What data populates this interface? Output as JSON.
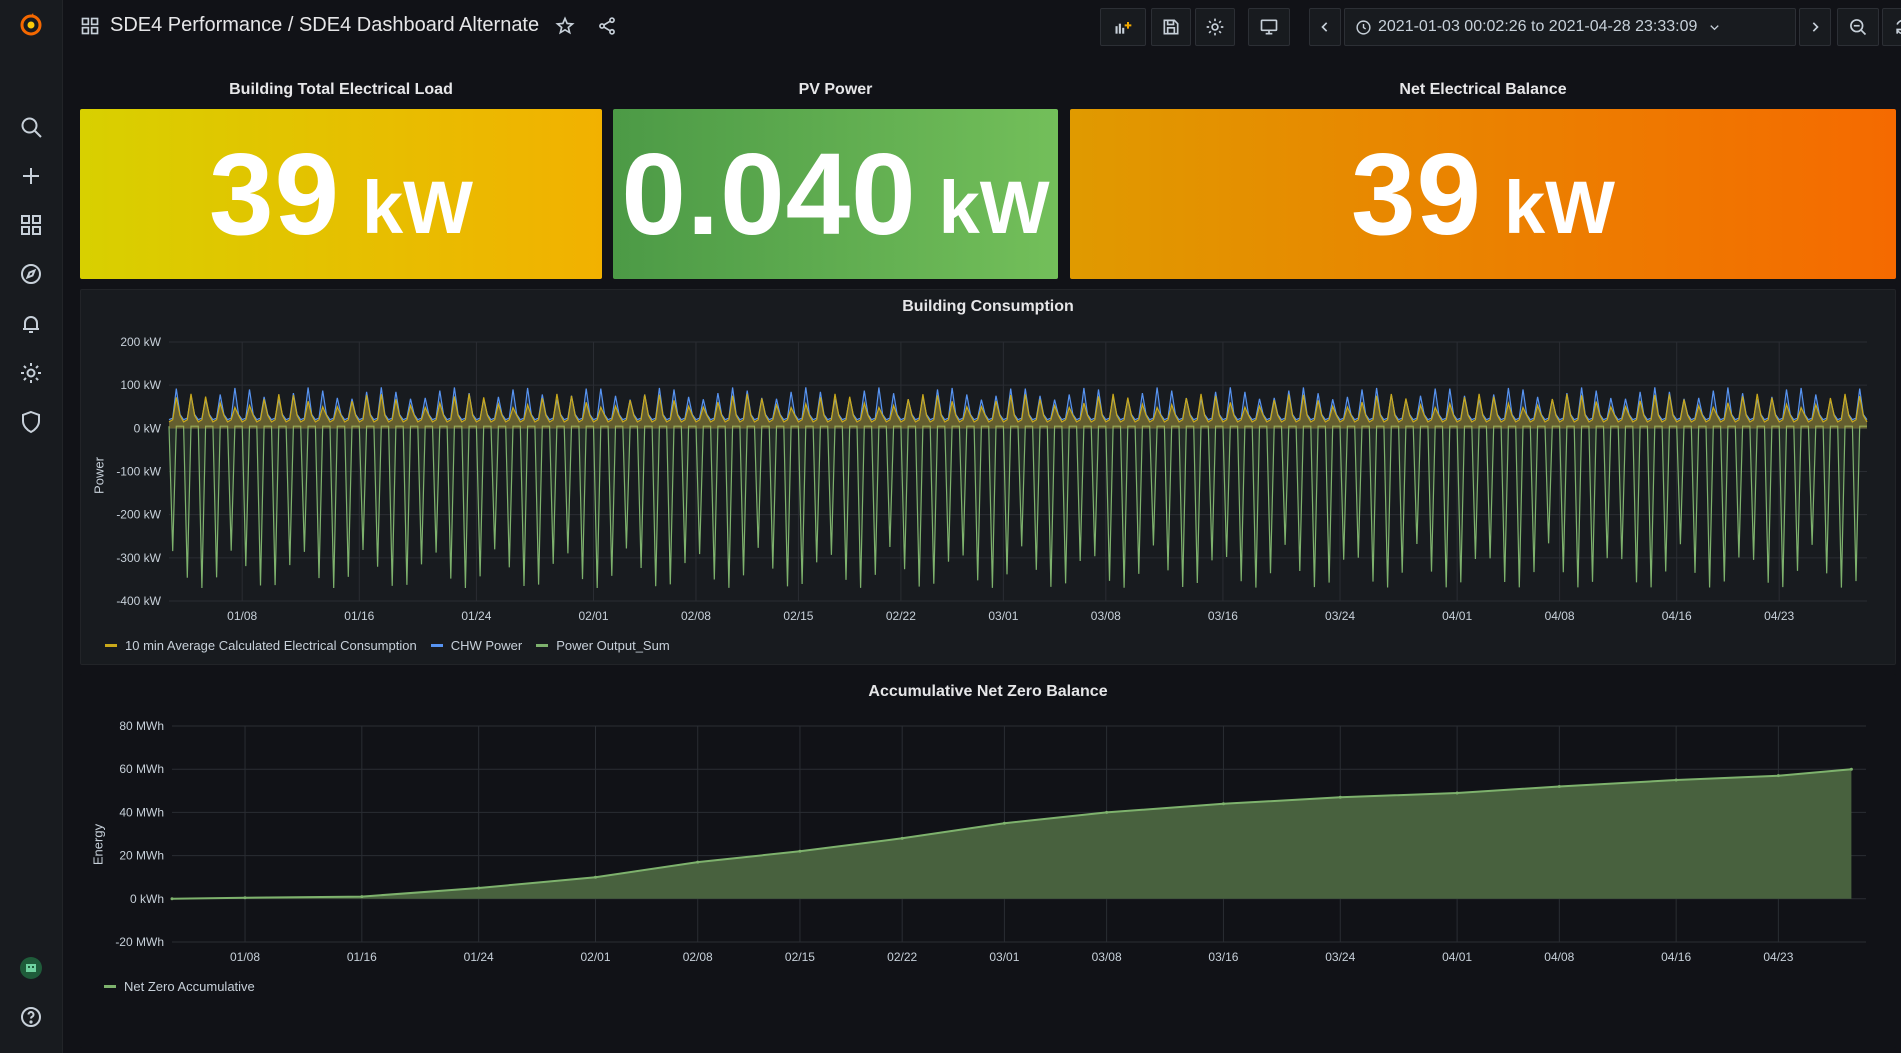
{
  "breadcrumb": {
    "folder": "SDE4 Performance",
    "separator": " / ",
    "dashboard": "SDE4 Dashboard Alternate"
  },
  "time_picker": {
    "range": "2021-01-03 00:02:26 to 2021-04-28 23:33:09"
  },
  "sidebar": {
    "items": [
      "grafana-logo-icon",
      "search-icon",
      "plus-icon",
      "dashboards-icon",
      "explore-icon",
      "alerting-icon",
      "configuration-icon",
      "server-admin-icon",
      "user-avatar",
      "help-icon"
    ]
  },
  "toolbar": {
    "icons": [
      "add-panel-icon",
      "save-icon",
      "settings-icon",
      "tv-mode-icon",
      "time-back-icon",
      "clock-icon",
      "time-forward-icon",
      "zoom-out-icon",
      "refresh-icon",
      "refresh-interval-chevron-icon"
    ]
  },
  "stats": [
    {
      "title": "Building Total Electrical Load",
      "value": "39",
      "unit": "kW",
      "gradient": [
        "#d8d000",
        "#f2b100"
      ]
    },
    {
      "title": "PV Power",
      "value": "0.040",
      "unit": "kW",
      "gradient": [
        "#4c9a46",
        "#73bf5a"
      ]
    },
    {
      "title": "Net Electrical Balance",
      "value": "39",
      "unit": "kW",
      "gradient": [
        "#e09a00",
        "#f56a00"
      ]
    }
  ],
  "colors": {
    "yellow": "#caa91a",
    "blue": "#5794f2",
    "green": "#7eb26d",
    "acc_fill": "#48613e"
  },
  "chart_data": [
    {
      "type": "line",
      "title": "Building Consumption",
      "ylabel": "Power",
      "xlabel": "",
      "ylim": [
        -400,
        200
      ],
      "yticks": [
        "200 kW",
        "100 kW",
        "0 kW",
        "-100 kW",
        "-200 kW",
        "-300 kW",
        "-400 kW"
      ],
      "xticks": [
        "01/08",
        "01/16",
        "01/24",
        "02/01",
        "02/08",
        "02/15",
        "02/22",
        "03/01",
        "03/08",
        "03/16",
        "03/24",
        "04/01",
        "04/08",
        "04/16",
        "04/23"
      ],
      "x_range": [
        "2021-01-03",
        "2021-04-28"
      ],
      "grid": true,
      "legend_position": "bottom-left",
      "series": [
        {
          "name": "10 min Average Calculated Electrical Consumption",
          "color": "#caa91a",
          "typical_base": 15,
          "typical_peak": 80
        },
        {
          "name": "CHW Power",
          "color": "#5794f2",
          "typical_base": 20,
          "typical_peak": 95
        },
        {
          "name": "Power Output_Sum",
          "color": "#7eb26d",
          "typical_base": 5,
          "typical_min": -370
        }
      ]
    },
    {
      "type": "area",
      "title": "Accumulative Net Zero Balance",
      "ylabel": "Energy",
      "xlabel": "",
      "ylim": [
        -20,
        80
      ],
      "yticks": [
        "80 MWh",
        "60 MWh",
        "40 MWh",
        "20 MWh",
        "0 kWh",
        "-20 MWh"
      ],
      "xticks": [
        "01/08",
        "01/16",
        "01/24",
        "02/01",
        "02/08",
        "02/15",
        "02/22",
        "03/01",
        "03/08",
        "03/16",
        "03/24",
        "04/01",
        "04/08",
        "04/16",
        "04/23"
      ],
      "x_range": [
        "2021-01-03",
        "2021-04-28"
      ],
      "grid": true,
      "legend_position": "bottom-left",
      "series": [
        {
          "name": "Net Zero Accumulative",
          "color": "#7eb26d",
          "points": [
            [
              "2021-01-03",
              0
            ],
            [
              "2021-01-08",
              0.5
            ],
            [
              "2021-01-16",
              1
            ],
            [
              "2021-01-24",
              5
            ],
            [
              "2021-02-01",
              10
            ],
            [
              "2021-02-08",
              17
            ],
            [
              "2021-02-15",
              22
            ],
            [
              "2021-02-22",
              28
            ],
            [
              "2021-03-01",
              35
            ],
            [
              "2021-03-08",
              40
            ],
            [
              "2021-03-16",
              44
            ],
            [
              "2021-03-24",
              47
            ],
            [
              "2021-04-01",
              49
            ],
            [
              "2021-04-08",
              52
            ],
            [
              "2021-04-16",
              55
            ],
            [
              "2021-04-23",
              57
            ],
            [
              "2021-04-28",
              60
            ]
          ]
        }
      ]
    }
  ]
}
